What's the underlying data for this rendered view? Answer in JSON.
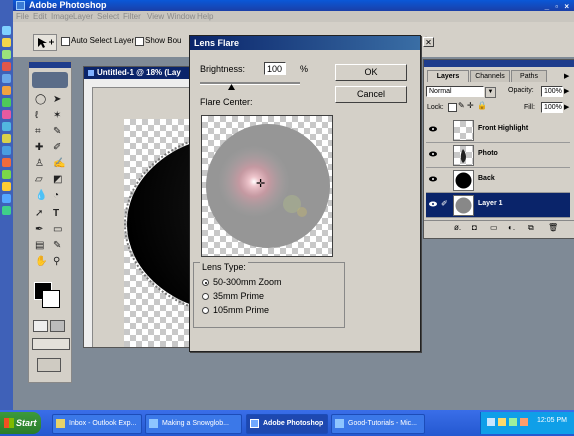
{
  "app": {
    "title": "Adobe Photoshop",
    "window_controls": "_ ▫ ×"
  },
  "menu": [
    "File",
    "Edit",
    "Image",
    "Layer",
    "Select",
    "Filter",
    "View",
    "Window",
    "Help"
  ],
  "options_bar": {
    "auto_select_label": "Auto Select Layer",
    "show_bounding_label": "Show Bou"
  },
  "document": {
    "title": "Untitled-1 @ 18% (Lay"
  },
  "dialog": {
    "title": "Lens Flare",
    "brightness_label": "Brightness:",
    "brightness_value": "100",
    "brightness_unit": "%",
    "flare_center_label": "Flare Center:",
    "ok_label": "OK",
    "cancel_label": "Cancel",
    "lens_type_label": "Lens Type:",
    "lens_options": [
      "50-300mm Zoom",
      "35mm Prime",
      "105mm Prime"
    ],
    "selected_lens": "50-300mm Zoom",
    "brightness_level_percent": 100
  },
  "layers_panel": {
    "tabs": [
      "Layers",
      "Channels",
      "Paths"
    ],
    "blend_mode": "Normal",
    "opacity_label": "Opacity:",
    "opacity_value": "100%",
    "lock_label": "Lock:",
    "fill_label": "Fill:",
    "fill_value": "100%",
    "layers": [
      {
        "name": "Front Highlight",
        "selected": false
      },
      {
        "name": "Photo",
        "selected": false
      },
      {
        "name": "Back",
        "selected": false
      },
      {
        "name": "Layer 1",
        "selected": true
      }
    ]
  },
  "taskbar": {
    "start_label": "Start",
    "buttons": [
      "Inbox - Outlook Exp...",
      "Making a Snowglob...",
      "Adobe Photoshop",
      "Good-Tutorials - Mic..."
    ],
    "active": "Adobe Photoshop",
    "clock": "12:05 PM"
  },
  "colors": {
    "title_bar": "#0a58d8",
    "dialog_title": "#0a246a",
    "selected_layer": "#0a246a",
    "taskbar": "#2458d0",
    "start_button": "#2a7d2a"
  }
}
